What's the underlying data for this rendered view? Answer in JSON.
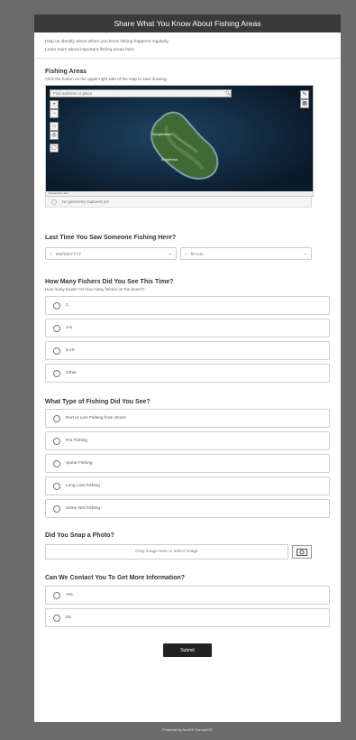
{
  "survey": {
    "title": "Share What You Know About Fishing Areas",
    "intro_line1": "Help us identify areas where you know fishing happens regularly.",
    "intro_line2": "Learn more about important fishing areas here.",
    "footer": "Powered by ArcGIS Survey123"
  },
  "fishing_areas": {
    "label": "Fishing Areas",
    "hint": "Click the button on the upper-right side of the map to start drawing.",
    "map_search_placeholder": "Find address or place",
    "map_attribution": "Powered by Esri",
    "map_place_labels": [
      "Speightstown",
      "Bridgetown"
    ],
    "no_geometry": "No geometry captured yet"
  },
  "last_time": {
    "label": "Last Time You Saw Someone Fishing Here?",
    "date_placeholder": "MM/DD/YYYY",
    "time_placeholder": "hh:mm"
  },
  "how_many": {
    "label": "How Many Fishers Did You See This Time?",
    "hint": "How many boats? Or how many fishers on the beach?",
    "options": [
      "1",
      "2-5",
      "5-10",
      "Other"
    ]
  },
  "fishing_type": {
    "label": "What Type of Fishing Did You See?",
    "options": [
      "Rod or Line Fishing from Shore",
      "Pot Fishing",
      "Spear Fishing",
      "Long Line Fishing",
      "Seine Net Fishing"
    ]
  },
  "photo": {
    "label": "Did You Snap a Photo?",
    "drop_text": "Drop image here or select image"
  },
  "contact": {
    "label": "Can We Contact You To Get More Information?",
    "options": [
      "Yes",
      "No"
    ]
  },
  "submit_label": "Submit"
}
